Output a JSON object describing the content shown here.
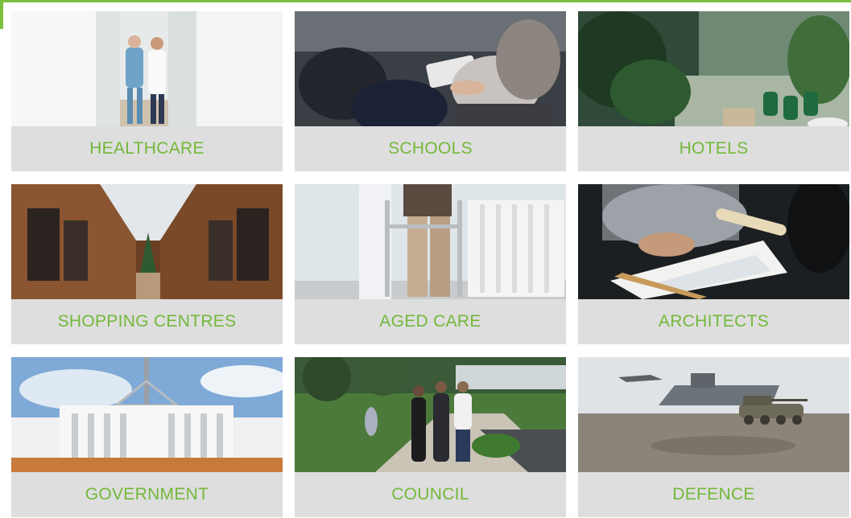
{
  "brand": {
    "accent": "#74b83a",
    "label_bg": "#dedede"
  },
  "tiles": [
    {
      "label": "HEALTHCARE",
      "image": "hospital-corridor-photo"
    },
    {
      "label": "SCHOOLS",
      "image": "students-writing-photo"
    },
    {
      "label": "HOTELS",
      "image": "hotel-atrium-plants-photo"
    },
    {
      "label": "SHOPPING CENTRES",
      "image": "shopping-arcade-photo"
    },
    {
      "label": "AGED CARE",
      "image": "walking-frame-photo"
    },
    {
      "label": "ARCHITECTS",
      "image": "architect-drawing-plans-photo"
    },
    {
      "label": "GOVERNMENT",
      "image": "parliament-house-photo"
    },
    {
      "label": "COUNCIL",
      "image": "park-joggers-photo"
    },
    {
      "label": "DEFENCE",
      "image": "military-ship-tank-photo"
    }
  ]
}
